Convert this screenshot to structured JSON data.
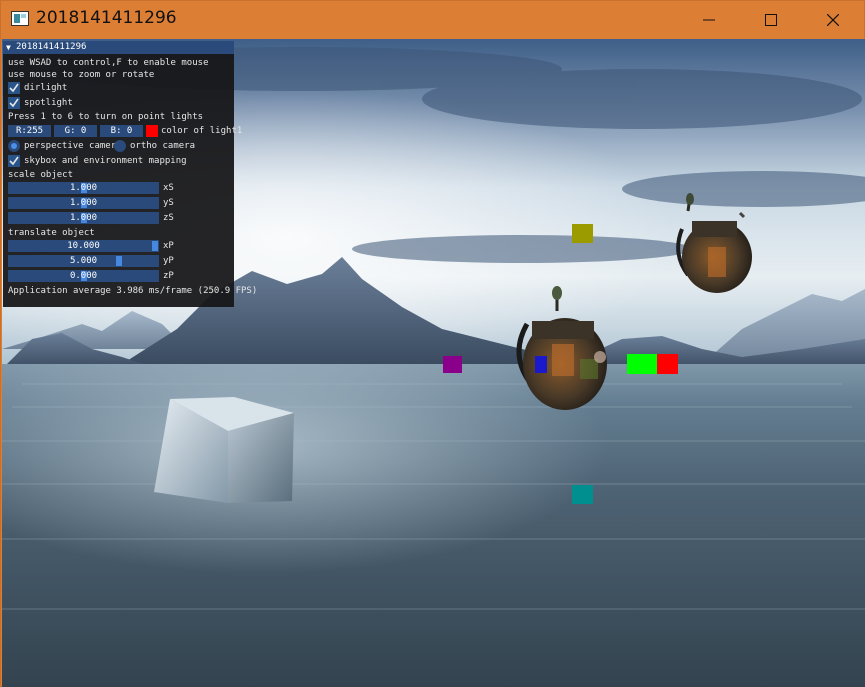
{
  "window": {
    "title": "2018141411296",
    "controls": {
      "minimize": "minimize",
      "maximize": "maximize",
      "close": "close"
    }
  },
  "panel": {
    "title": "2018141411296",
    "help_lines": [
      "use WSAD to control,F to enable mouse",
      "use mouse to zoom or rotate"
    ],
    "checkboxes": [
      {
        "label": "dirlight",
        "checked": true
      },
      {
        "label": "spotlight",
        "checked": true
      }
    ],
    "point_lights_hint": "Press 1 to 6 to turn on point lights",
    "color": {
      "r": "R:255",
      "g": "G:  0",
      "b": "B:  0",
      "swatch": "#ff0000",
      "label": "color of light1"
    },
    "camera": {
      "options": [
        "perspective camera",
        "ortho camera"
      ],
      "selected": "perspective camera"
    },
    "skybox": {
      "label": "skybox and environment mapping",
      "checked": true
    },
    "scale": {
      "heading": "scale object",
      "sliders": [
        {
          "label": "xS",
          "value": "1.000",
          "level": 0.5
        },
        {
          "label": "yS",
          "value": "1.000",
          "level": 0.5
        },
        {
          "label": "zS",
          "value": "1.000",
          "level": 0.5
        }
      ]
    },
    "translate": {
      "heading": "translate object",
      "sliders": [
        {
          "label": "xP",
          "value": "10.000",
          "level": 1.0
        },
        {
          "label": "yP",
          "value": "5.000",
          "level": 0.75
        },
        {
          "label": "zP",
          "value": "0.000",
          "level": 0.5
        }
      ]
    },
    "stats": "Application average 3.986 ms/frame (250.9 FPS)"
  },
  "scene": {
    "point_light_colors": [
      "#9b9b00",
      "#8a008a",
      "#1a1acc",
      "#00ff00",
      "#ff0000",
      "#008f8f"
    ],
    "objects": [
      "reflective cube",
      "backpack",
      "backpack"
    ]
  }
}
